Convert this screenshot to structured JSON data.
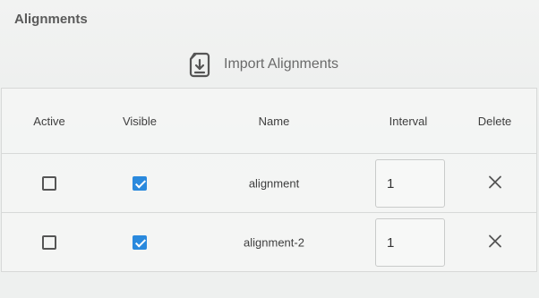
{
  "panel": {
    "title": "Alignments"
  },
  "import": {
    "label": "Import Alignments",
    "icon": "import-file-icon"
  },
  "table": {
    "columns": [
      "Active",
      "Visible",
      "Name",
      "Interval",
      "Delete"
    ],
    "rows": [
      {
        "active": false,
        "visible": true,
        "name": "alignment",
        "interval": "1"
      },
      {
        "active": false,
        "visible": true,
        "name": "alignment-2",
        "interval": "1"
      }
    ]
  },
  "colors": {
    "accent": "#2a89dd",
    "text": "#3e3e3e",
    "border": "#d7d9d8"
  }
}
